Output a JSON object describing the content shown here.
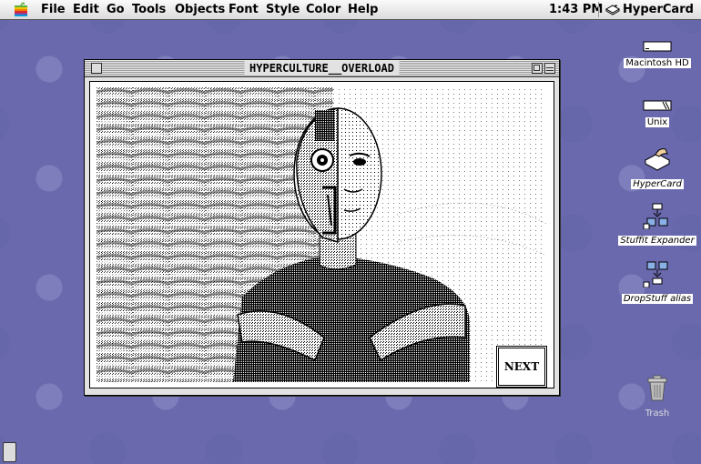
{
  "menubar": {
    "items": [
      "File",
      "Edit",
      "Go",
      "Tools",
      "Objects",
      "Font",
      "Style",
      "Color",
      "Help"
    ],
    "clock": "1:43 PM",
    "app_name": "HyperCard"
  },
  "window": {
    "title": "HYPERCULTURE__OVERLOAD",
    "next_label": "NEXT"
  },
  "desktop_icons": [
    {
      "label": "Macintosh HD",
      "icon": "hard-disk-icon"
    },
    {
      "label": "Unix",
      "icon": "disk-icon"
    },
    {
      "label": "HyperCard",
      "icon": "hypercard-stack-icon"
    },
    {
      "label": "Stuffit Expander",
      "icon": "stuffit-expander-icon"
    },
    {
      "label": "DropStuff alias",
      "icon": "dropstuff-alias-icon"
    },
    {
      "label": "Trash",
      "icon": "trash-icon"
    }
  ],
  "colors": {
    "desktop": "#6a69ae",
    "menubar": "#e8e8e8"
  }
}
